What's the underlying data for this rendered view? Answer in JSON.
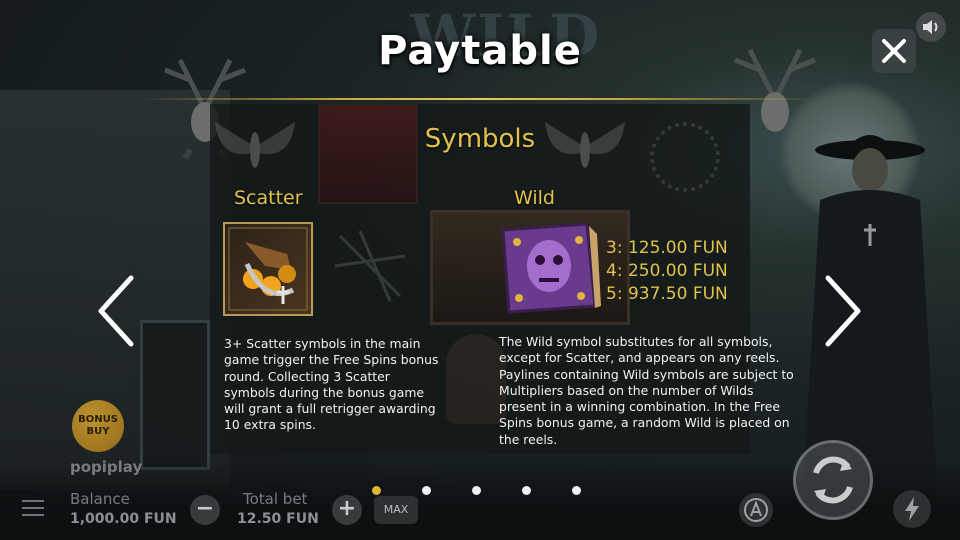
{
  "title": "Paytable",
  "background": {
    "logo_text": "WILD"
  },
  "section_title": "Symbols",
  "scatter": {
    "label": "Scatter",
    "description": "3+ Scatter symbols in the main game trigger the Free Spins bonus round. Collecting 3 Scatter symbols during the bonus game will grant a full retrigger awarding 10 extra spins."
  },
  "wild": {
    "label": "Wild",
    "payouts": [
      "3: 125.00 FUN",
      "4: 250.00 FUN",
      "5: 937.50 FUN"
    ],
    "description": "The Wild symbol substitutes for all symbols, except for Scatter, and appears on any reels. Paylines containing Wild symbols are subject to Multipliers based on the number of Wilds present in a winning combination. In the Free Spins bonus game, a random Wild is placed on the reels."
  },
  "pagination": {
    "total": 5,
    "active_index": 0
  },
  "bottom_bar": {
    "balance_label": "Balance",
    "balance_value": "1,000.00 FUN",
    "total_bet_label": "Total bet",
    "total_bet_value": "12.50 FUN",
    "minus_label": "−",
    "plus_label": "+",
    "max_label": "MAX",
    "bonus_buy_line1": "BONUS",
    "bonus_buy_line2": "BUY",
    "brand": "popiplay"
  },
  "colors": {
    "accent_gold": "#e2c24a",
    "active_dot": "#e2b434"
  },
  "icons": [
    "close-icon",
    "sound-icon",
    "chevron-left-icon",
    "chevron-right-icon",
    "menu-icon",
    "autoplay-icon",
    "spin-icon",
    "turbo-icon"
  ]
}
